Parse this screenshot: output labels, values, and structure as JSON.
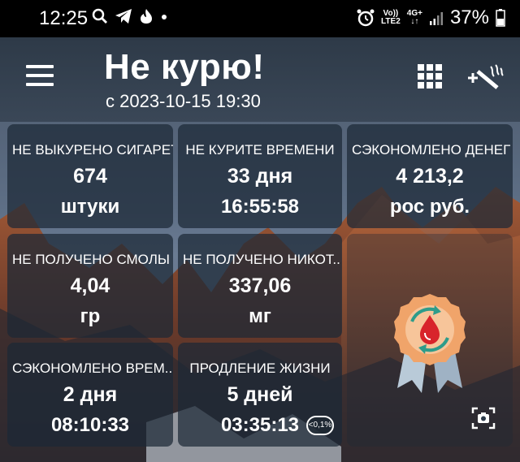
{
  "status_bar": {
    "time": "12:25",
    "network_top": "Vo))",
    "network_bottom": "LTE2",
    "data_top": "4G+",
    "data_bottom": "↓↑",
    "battery": "37%"
  },
  "header": {
    "title": "Не курю!",
    "subtitle": "с 2023-10-15 19:30"
  },
  "tiles": [
    {
      "label": "НЕ ВЫКУРЕНО СИГАРЕТ",
      "value": "674",
      "unit": "штуки"
    },
    {
      "label": "НЕ КУРИТЕ ВРЕМЕНИ",
      "value": "33 дня",
      "unit": "16:55:58"
    },
    {
      "label": "СЭКОНОМЛЕНО ДЕНЕГ",
      "value": "4 213,2",
      "unit": "рос руб."
    },
    {
      "label": "НЕ ПОЛУЧЕНО СМОЛЫ",
      "value": "4,04",
      "unit": "гр"
    },
    {
      "label": "НЕ ПОЛУЧЕНО НИКОТ..",
      "value": "337,06",
      "unit": "мг"
    },
    {
      "label": "СЭКОНОМЛЕНО ВРЕМ..",
      "value": "2 дня",
      "unit": "08:10:33"
    },
    {
      "label": "ПРОДЛЕНИЕ ЖИЗНИ",
      "value": "5 дней",
      "unit": "03:35:13"
    }
  ],
  "percent_badge": "<0,1%",
  "icons": {
    "menu": "hamburger-menu-icon",
    "grid": "grid-icon",
    "add_smoke": "add-cigarette-icon",
    "award": "blood-drop-award-icon",
    "camera": "camera-icon"
  },
  "colors": {
    "status_bar": "#000000",
    "tile_bg": "#1c2836",
    "award_orange": "#f0a46a",
    "award_red": "#d8242b",
    "ribbon": "#b9cad8"
  }
}
